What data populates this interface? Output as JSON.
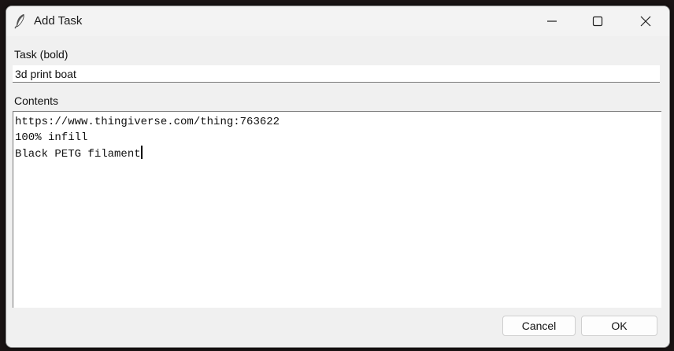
{
  "window": {
    "title": "Add Task",
    "icon": "feather-icon",
    "controls": {
      "minimize_icon": "minimize-icon",
      "maximize_icon": "maximize-icon",
      "close_icon": "close-icon"
    }
  },
  "form": {
    "task_label": "Task (bold)",
    "task_value": "3d print boat",
    "contents_label": "Contents",
    "contents_lines": [
      "https://www.thingiverse.com/thing:763622",
      "100% infill",
      "Black PETG filament"
    ]
  },
  "buttons": {
    "cancel_label": "Cancel",
    "ok_label": "OK"
  }
}
